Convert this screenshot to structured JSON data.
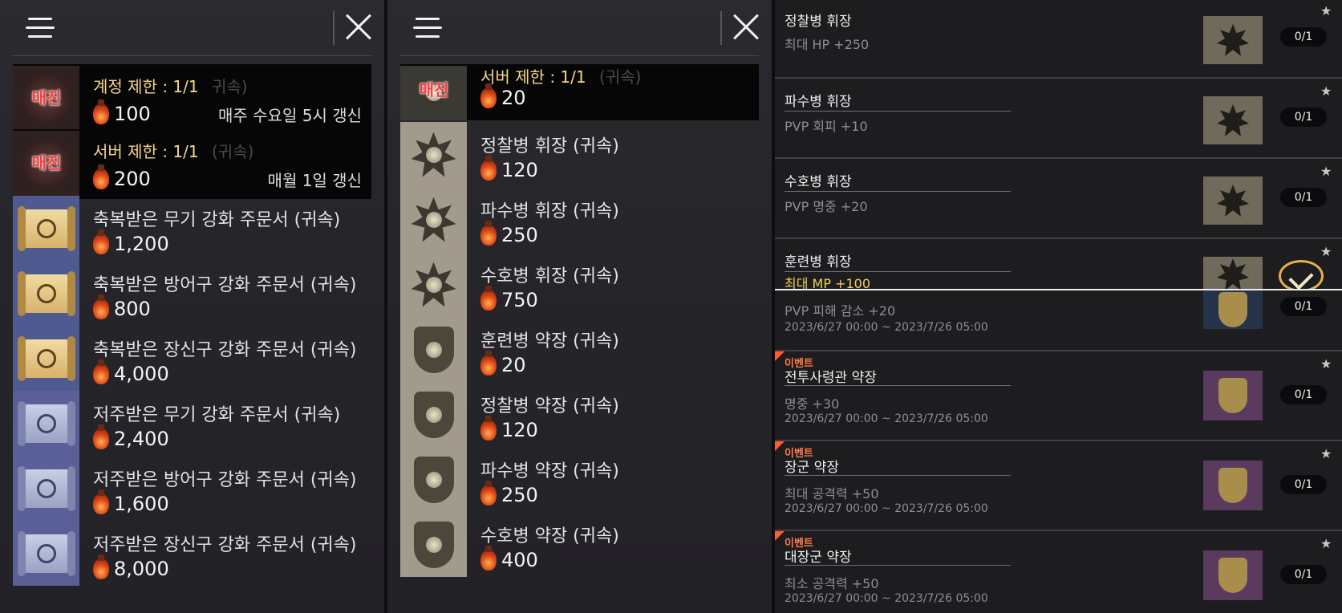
{
  "p1": {
    "rows": [
      {
        "type": "limited",
        "limit": "계정 제한 : 1/1",
        "ghost": "귀속)",
        "soldout": "매진",
        "price": "100",
        "renew": "매주 수요일 5시 갱신"
      },
      {
        "type": "limited",
        "limit": "서버 제한 : 1/1",
        "ghost": "(귀속)",
        "soldout": "매진",
        "price": "200",
        "renew": "매월 1일 갱신"
      },
      {
        "type": "scroll",
        "name": "축복받은 무기 강화 주문서 (귀속)",
        "price": "1,200"
      },
      {
        "type": "scroll",
        "name": "축복받은 방어구 강화 주문서 (귀속)",
        "price": "800"
      },
      {
        "type": "scroll",
        "name": "축복받은 장신구 강화 주문서 (귀속)",
        "price": "4,000"
      },
      {
        "type": "cursed",
        "name": "저주받은 무기 강화 주문서 (귀속)",
        "price": "2,400"
      },
      {
        "type": "cursed",
        "name": "저주받은 방어구 강화 주문서 (귀속)",
        "price": "1,600"
      },
      {
        "type": "cursed",
        "name": "저주받은 장신구 강화 주문서 (귀속)",
        "price": "8,000"
      }
    ]
  },
  "p2": {
    "rows": [
      {
        "type": "limited",
        "limit": "서버 제한 : 1/1",
        "ghost": "(귀속)",
        "soldout": "매진",
        "price": "20"
      },
      {
        "type": "badge",
        "name": "정찰병 휘장 (귀속)",
        "price": "120"
      },
      {
        "type": "badge",
        "name": "파수병 휘장 (귀속)",
        "price": "250"
      },
      {
        "type": "badge",
        "name": "수호병 휘장 (귀속)",
        "price": "750"
      },
      {
        "type": "shield",
        "name": "훈련병 약장 (귀속)",
        "price": "20"
      },
      {
        "type": "shield",
        "name": "정찰병 약장 (귀속)",
        "price": "120"
      },
      {
        "type": "shield",
        "name": "파수병 약장 (귀속)",
        "price": "250"
      },
      {
        "type": "shield",
        "name": "수호병 약장 (귀속)",
        "price": "400"
      }
    ]
  },
  "p3": {
    "items": [
      {
        "title": "정찰병 휘장",
        "desc": "최대 HP +250",
        "count": "0/1"
      },
      {
        "title": "파수병 휘장",
        "desc": "PVP 회피 +10",
        "count": "0/1"
      },
      {
        "title": "수호병 휘장",
        "desc": "PVP 명중 +20",
        "count": "0/1"
      },
      {
        "title": "훈련병 휘장",
        "desc": "최대 MP +100",
        "count": ""
      },
      {
        "title": "",
        "desc": "PVP 피해 감소 +20",
        "date": "2023/6/27 00:00 ~ 2023/7/26 05:00",
        "count": "0/1"
      },
      {
        "event": "이벤트",
        "title": "전투사령관 약장",
        "desc": "명중 +30",
        "date": "2023/6/27 00:00 ~ 2023/7/26 05:00",
        "count": "0/1"
      },
      {
        "event": "이벤트",
        "title": "장군 약장",
        "desc": "최대 공격력 +50",
        "date": "2023/6/27 00:00 ~ 2023/7/26 05:00",
        "count": "0/1"
      },
      {
        "event": "이벤트",
        "title": "대장군 약장",
        "desc": "최소 공격력 +50",
        "date": "2023/6/27 00:00 ~ 2023/7/26 05:00",
        "count": "0/1"
      }
    ]
  }
}
